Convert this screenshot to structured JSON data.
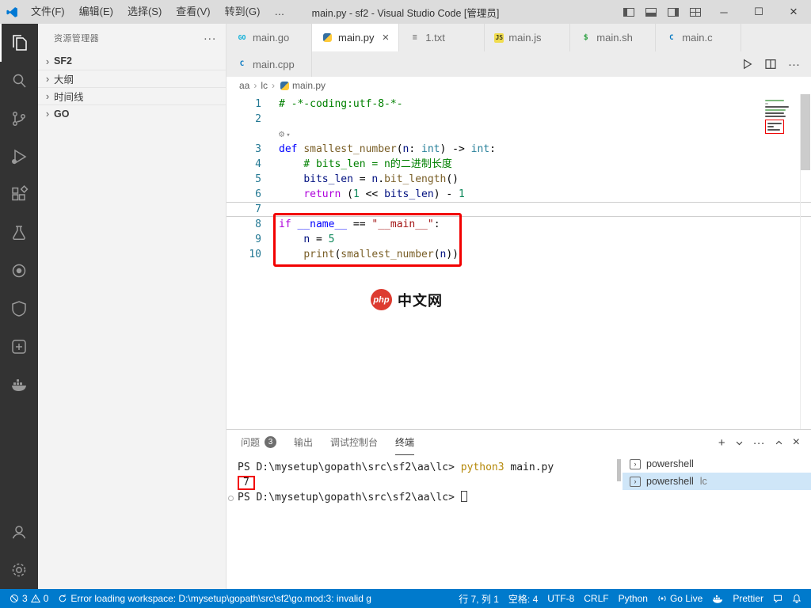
{
  "title_bar": {
    "menus": [
      "文件(F)",
      "编辑(E)",
      "选择(S)",
      "查看(V)",
      "转到(G)",
      "…"
    ],
    "title": "main.py - sf2 - Visual Studio Code [管理员]"
  },
  "sidebar": {
    "title": "资源管理器",
    "items": [
      {
        "label": "SF2",
        "bold": true
      },
      {
        "label": "大纲"
      },
      {
        "label": "时间线"
      },
      {
        "label": "GO",
        "bold": true
      }
    ]
  },
  "tabs": {
    "row1": [
      {
        "label": "main.go",
        "icon": "go"
      },
      {
        "label": "main.py",
        "icon": "py",
        "active": true
      },
      {
        "label": "1.txt",
        "icon": "txt"
      },
      {
        "label": "main.js",
        "icon": "js"
      },
      {
        "label": "main.sh",
        "icon": "sh"
      },
      {
        "label": "main.c",
        "icon": "c"
      }
    ],
    "row2": [
      {
        "label": "main.cpp",
        "icon": "cpp"
      }
    ]
  },
  "breadcrumb": [
    {
      "label": "aa"
    },
    {
      "label": "lc"
    },
    {
      "label": "main.py",
      "icon": "py"
    }
  ],
  "editor": {
    "lines": [
      {
        "num": "1",
        "segs": [
          {
            "t": "# -*-coding:utf-8-*-",
            "c": "comment"
          }
        ]
      },
      {
        "num": "2",
        "segs": []
      },
      {
        "lens": true,
        "segs": []
      },
      {
        "num": "3",
        "segs": [
          {
            "t": "def ",
            "c": "kw"
          },
          {
            "t": "smallest_number",
            "c": "fn"
          },
          {
            "t": "(",
            "c": "plain"
          },
          {
            "t": "n",
            "c": "var"
          },
          {
            "t": ": ",
            "c": "plain"
          },
          {
            "t": "int",
            "c": "type"
          },
          {
            "t": ") -> ",
            "c": "plain"
          },
          {
            "t": "int",
            "c": "type"
          },
          {
            "t": ":",
            "c": "plain"
          }
        ]
      },
      {
        "num": "4",
        "segs": [
          {
            "t": "    # bits_len = n的二进制长度",
            "c": "comment"
          }
        ]
      },
      {
        "num": "5",
        "segs": [
          {
            "t": "    ",
            "c": "plain"
          },
          {
            "t": "bits_len",
            "c": "var"
          },
          {
            "t": " = ",
            "c": "plain"
          },
          {
            "t": "n",
            "c": "var"
          },
          {
            "t": ".",
            "c": "plain"
          },
          {
            "t": "bit_length",
            "c": "fn"
          },
          {
            "t": "()",
            "c": "plain"
          }
        ]
      },
      {
        "num": "6",
        "segs": [
          {
            "t": "    ",
            "c": "plain"
          },
          {
            "t": "return",
            "c": "ctrl"
          },
          {
            "t": " (",
            "c": "plain"
          },
          {
            "t": "1",
            "c": "num"
          },
          {
            "t": " << ",
            "c": "plain"
          },
          {
            "t": "bits_len",
            "c": "var"
          },
          {
            "t": ") - ",
            "c": "plain"
          },
          {
            "t": "1",
            "c": "num"
          }
        ]
      },
      {
        "num": "7",
        "current": true,
        "segs": []
      },
      {
        "num": "8",
        "segs": [
          {
            "t": "if",
            "c": "ctrl"
          },
          {
            "t": " ",
            "c": "plain"
          },
          {
            "t": "__name__",
            "c": "kw"
          },
          {
            "t": " == ",
            "c": "plain"
          },
          {
            "t": "\"__main__\"",
            "c": "str"
          },
          {
            "t": ":",
            "c": "plain"
          }
        ]
      },
      {
        "num": "9",
        "segs": [
          {
            "t": "    ",
            "c": "plain"
          },
          {
            "t": "n",
            "c": "var"
          },
          {
            "t": " = ",
            "c": "plain"
          },
          {
            "t": "5",
            "c": "num"
          }
        ]
      },
      {
        "num": "10",
        "segs": [
          {
            "t": "    ",
            "c": "plain"
          },
          {
            "t": "print",
            "c": "fn"
          },
          {
            "t": "(",
            "c": "plain"
          },
          {
            "t": "smallest_number",
            "c": "fn"
          },
          {
            "t": "(",
            "c": "plain"
          },
          {
            "t": "n",
            "c": "var"
          },
          {
            "t": "))",
            "c": "plain"
          }
        ]
      }
    ]
  },
  "watermark": {
    "brand": "php",
    "text": "中文网"
  },
  "panel": {
    "tabs": [
      {
        "label": "问题",
        "badge": "3"
      },
      {
        "label": "输出"
      },
      {
        "label": "调试控制台"
      },
      {
        "label": "终端",
        "active": true
      }
    ],
    "terminal": {
      "lines": [
        {
          "segs": [
            {
              "t": "PS D:\\mysetup\\gopath\\src\\sf2\\aa\\lc> ",
              "c": "def"
            },
            {
              "t": "python3",
              "c": "cmd"
            },
            {
              "t": " main.py",
              "c": "def"
            }
          ]
        },
        {
          "segs": [
            {
              "t": "7",
              "c": "def",
              "box": true
            }
          ]
        },
        {
          "dot": true,
          "cursor": true,
          "segs": [
            {
              "t": "PS D:\\mysetup\\gopath\\src\\sf2\\aa\\lc> ",
              "c": "def"
            }
          ]
        }
      ],
      "list": [
        {
          "label": "powershell"
        },
        {
          "label": "powershell",
          "suffix": "lc",
          "selected": true
        }
      ]
    }
  },
  "status_bar": {
    "problems": {
      "errors": "3",
      "warnings": "0"
    },
    "message": "Error loading workspace: D:\\mysetup\\gopath\\src\\sf2\\go.mod:3: invalid g",
    "right": [
      {
        "name": "cursor-position",
        "label": "行 7, 列 1"
      },
      {
        "name": "indentation",
        "label": "空格: 4"
      },
      {
        "name": "encoding",
        "label": "UTF-8"
      },
      {
        "name": "eol",
        "label": "CRLF"
      },
      {
        "name": "language-mode",
        "label": "Python"
      },
      {
        "name": "go-live",
        "icon": "broadcast",
        "label": "Go Live"
      },
      {
        "name": "docker",
        "icon": "docker",
        "label": ""
      },
      {
        "name": "prettier",
        "label": "Prettier"
      },
      {
        "name": "feedback",
        "icon": "feedback",
        "label": ""
      },
      {
        "name": "notifications",
        "icon": "bell",
        "label": ""
      }
    ]
  }
}
